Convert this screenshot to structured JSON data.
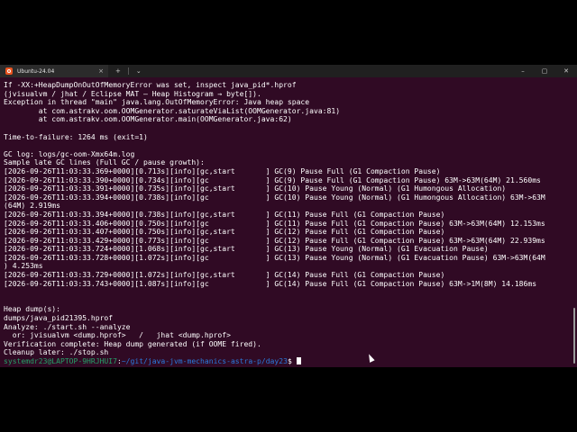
{
  "window": {
    "tab_title": "Ubuntu-24.04",
    "tab_close": "×",
    "new_tab": "+",
    "dropdown": "⌄",
    "minimize": "–",
    "maximize": "▢",
    "close": "✕"
  },
  "terminal": {
    "lines": [
      "If -XX:+HeapDumpOnOutOfMemoryError was set, inspect java_pid*.hprof",
      "(jvisualvm / jhat / Eclipse MAT – Heap Histogram → byte[]).",
      "Exception in thread \"main\" java.lang.OutOfMemoryError: Java heap space",
      "        at com.astrakv.oom.OOMGenerator.saturateViaList(OOMGenerator.java:81)",
      "        at com.astrakv.oom.OOMGenerator.main(OOMGenerator.java:62)",
      "",
      "Time-to-failure: 1264 ms (exit=1)",
      "",
      "GC log: logs/gc-oom-Xmx64m.log",
      "Sample late GC lines (Full GC / pause growth):",
      "[2026-09-26T11:03:33.369+0000][0.713s][info][gc,start       ] GC(9) Pause Full (G1 Compaction Pause)",
      "[2026-09-26T11:03:33.390+0000][0.734s][info][gc             ] GC(9) Pause Full (G1 Compaction Pause) 63M->63M(64M) 21.560ms",
      "[2026-09-26T11:03:33.391+0000][0.735s][info][gc,start       ] GC(10) Pause Young (Normal) (G1 Humongous Allocation)",
      "[2026-09-26T11:03:33.394+0000][0.738s][info][gc             ] GC(10) Pause Young (Normal) (G1 Humongous Allocation) 63M->63M",
      "(64M) 2.919ms",
      "[2026-09-26T11:03:33.394+0000][0.738s][info][gc,start       ] GC(11) Pause Full (G1 Compaction Pause)",
      "[2026-09-26T11:03:33.406+0000][0.750s][info][gc             ] GC(11) Pause Full (G1 Compaction Pause) 63M->63M(64M) 12.153ms",
      "[2026-09-26T11:03:33.407+0000][0.750s][info][gc,start       ] GC(12) Pause Full (G1 Compaction Pause)",
      "[2026-09-26T11:03:33.429+0000][0.773s][info][gc             ] GC(12) Pause Full (G1 Compaction Pause) 63M->63M(64M) 22.939ms",
      "[2026-09-26T11:03:33.724+0000][1.068s][info][gc,start       ] GC(13) Pause Young (Normal) (G1 Evacuation Pause)",
      "[2026-09-26T11:03:33.728+0000][1.072s][info][gc             ] GC(13) Pause Young (Normal) (G1 Evacuation Pause) 63M->63M(64M",
      ") 4.253ms",
      "[2026-09-26T11:03:33.729+0000][1.072s][info][gc,start       ] GC(14) Pause Full (G1 Compaction Pause)",
      "[2026-09-26T11:03:33.743+0000][1.087s][info][gc             ] GC(14) Pause Full (G1 Compaction Pause) 63M->1M(8M) 14.186ms",
      "",
      "",
      "Heap dump(s):",
      "dumps/java_pid21395.hprof",
      "Analyze: ./start.sh --analyze",
      "  or: jvisualvm <dump.hprof>   /   jhat <dump.hprof>",
      "Verification complete: Heap dump generated (if OOME fired).",
      "Cleanup later: ./stop.sh"
    ],
    "prompt_user": "systemdr23@LAPTOP-9HRJHUI7",
    "prompt_sep": ":",
    "prompt_path": "~/git/java-jvm-mechanics-astra-p/day23",
    "prompt_end": "$ "
  }
}
